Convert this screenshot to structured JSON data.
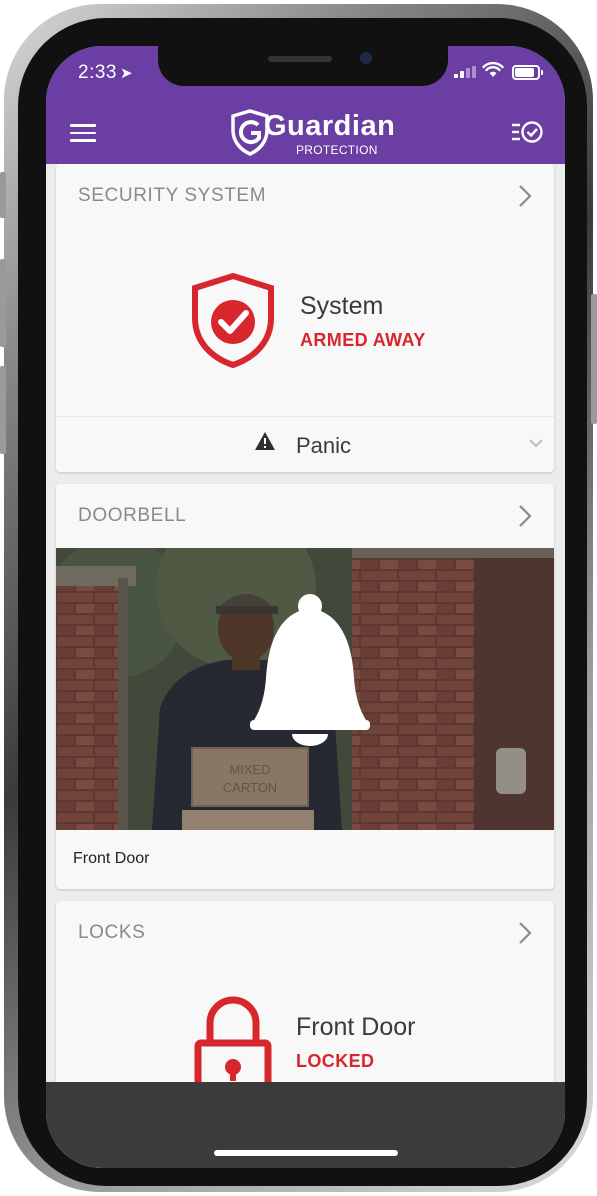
{
  "status_bar": {
    "time": "2:33"
  },
  "header": {
    "logo_word": "Guardian",
    "logo_sub": "PROTECTION"
  },
  "security": {
    "title": "SECURITY SYSTEM",
    "label": "System",
    "status": "ARMED AWAY",
    "panic_label": "Panic"
  },
  "doorbell": {
    "title": "DOORBELL",
    "camera_name": "Front Door",
    "box_text_1": "MIXED",
    "box_text_2": "CARTON"
  },
  "locks": {
    "title": "LOCKS",
    "name": "Front Door",
    "status": "LOCKED"
  },
  "colors": {
    "brand": "#6a3ea3",
    "alert": "#d8262d",
    "bottom_bar": "#3b3b3b"
  }
}
